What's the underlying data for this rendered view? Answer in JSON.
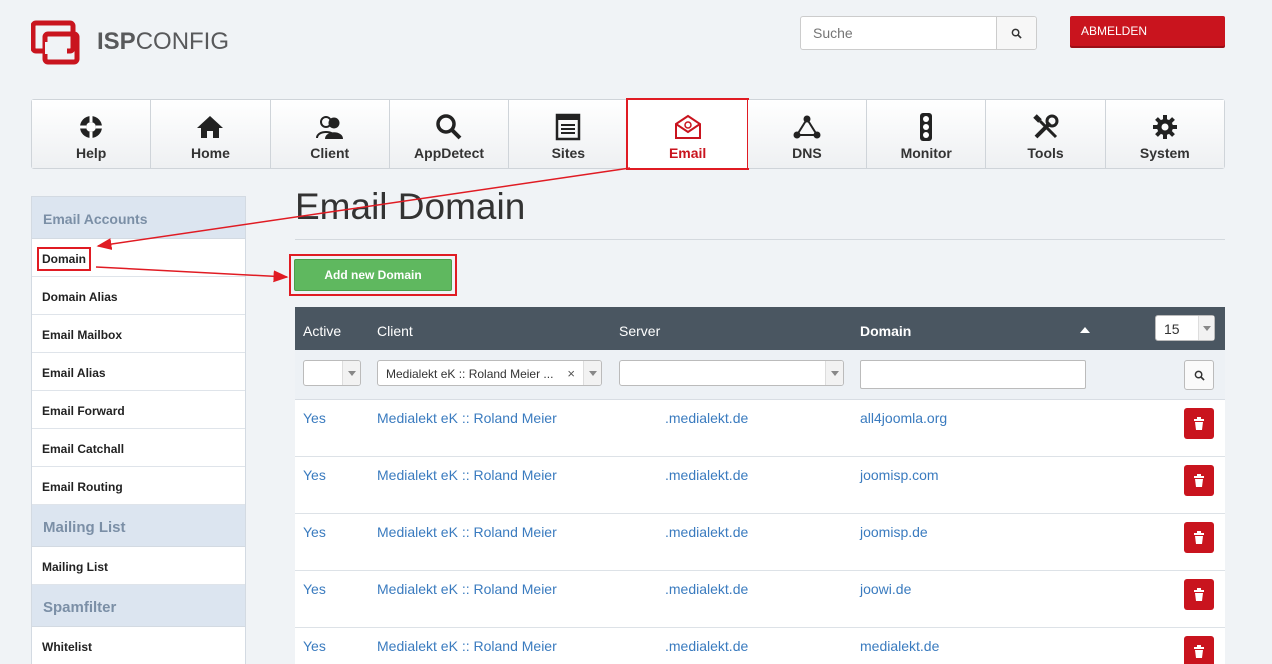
{
  "header": {
    "logo_isp": "ISP",
    "logo_config": "CONFIG",
    "search_placeholder": "Suche",
    "logout_label": "ABMELDEN"
  },
  "nav": [
    {
      "label": "Help",
      "icon": "lifebuoy-icon"
    },
    {
      "label": "Home",
      "icon": "home-icon"
    },
    {
      "label": "Client",
      "icon": "users-icon"
    },
    {
      "label": "AppDetect",
      "icon": "magnifier-icon"
    },
    {
      "label": "Sites",
      "icon": "browser-window-icon"
    },
    {
      "label": "Email",
      "icon": "envelope-at-icon",
      "active": true
    },
    {
      "label": "DNS",
      "icon": "network-nodes-icon"
    },
    {
      "label": "Monitor",
      "icon": "traffic-light-icon"
    },
    {
      "label": "Tools",
      "icon": "wrench-screwdriver-icon"
    },
    {
      "label": "System",
      "icon": "gear-icon"
    }
  ],
  "sidebar": {
    "sections": [
      {
        "title": "Email Accounts",
        "items": [
          "Domain",
          "Domain Alias",
          "Email Mailbox",
          "Email Alias",
          "Email Forward",
          "Email Catchall",
          "Email Routing"
        ]
      },
      {
        "title": "Mailing List",
        "items": [
          "Mailing List"
        ]
      },
      {
        "title": "Spamfilter",
        "items": [
          "Whitelist"
        ]
      }
    ],
    "active_item": "Domain"
  },
  "main": {
    "title": "Email Domain",
    "add_button": "Add new Domain"
  },
  "table": {
    "columns": [
      "Active",
      "Client",
      "Server",
      "Domain"
    ],
    "sorted_column": "Domain",
    "per_page": "15",
    "filters": {
      "client": "Medialekt eK :: Roland Meier ..."
    },
    "rows": [
      {
        "active": "Yes",
        "client": "Medialekt eK :: Roland Meier",
        "server": ".medialekt.de",
        "domain": "all4joomla.org"
      },
      {
        "active": "Yes",
        "client": "Medialekt eK :: Roland Meier",
        "server": ".medialekt.de",
        "domain": "joomisp.com"
      },
      {
        "active": "Yes",
        "client": "Medialekt eK :: Roland Meier",
        "server": ".medialekt.de",
        "domain": "joomisp.de"
      },
      {
        "active": "Yes",
        "client": "Medialekt eK :: Roland Meier",
        "server": ".medialekt.de",
        "domain": "joowi.de"
      },
      {
        "active": "Yes",
        "client": "Medialekt eK :: Roland Meier",
        "server": ".medialekt.de",
        "domain": "medialekt.de"
      }
    ]
  },
  "colors": {
    "accent_red": "#c9141e",
    "annotation_red": "#e01b23",
    "table_header": "#4a5661",
    "link_blue": "#3a7bbf",
    "button_green": "#5fb85f"
  }
}
